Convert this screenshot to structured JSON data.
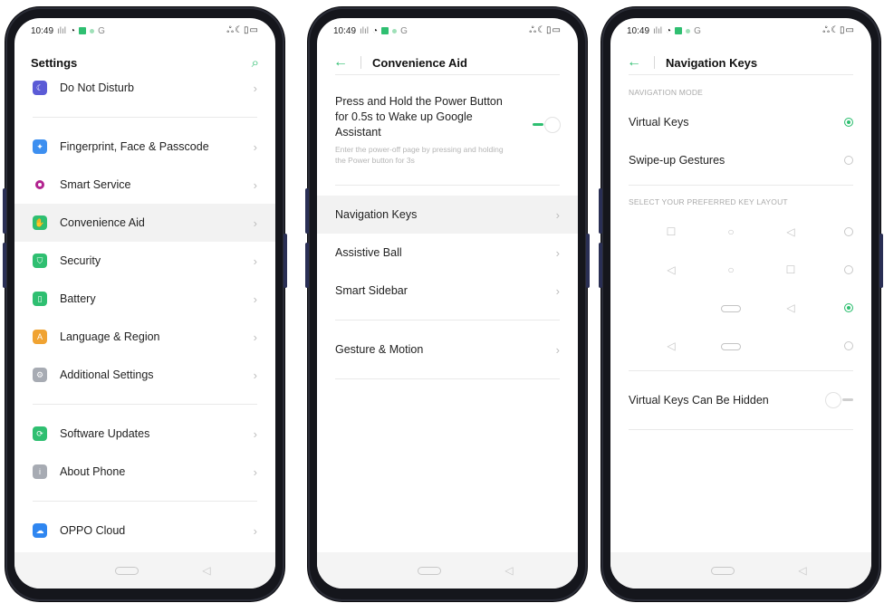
{
  "status": {
    "time": "10:49",
    "signal": "📶",
    "right_icons": "ஃ☾▯▭"
  },
  "colors": {
    "accent": "#2fbf71"
  },
  "screen1": {
    "title": "Settings",
    "search_icon": "search-icon",
    "items": [
      {
        "label": "Do Not Disturb",
        "icon": "moon-icon",
        "color": "#5b5bd6"
      },
      {
        "label": "Fingerprint, Face & Passcode",
        "icon": "fingerprint-icon",
        "color": "#3d8ff0"
      },
      {
        "label": "Smart Service",
        "icon": "circle-dot-icon",
        "color": "#b2238f"
      },
      {
        "label": "Convenience Aid",
        "icon": "hand-icon",
        "color": "#2fbf71"
      },
      {
        "label": "Security",
        "icon": "shield-icon",
        "color": "#2fbf71"
      },
      {
        "label": "Battery",
        "icon": "battery-icon",
        "color": "#2fbf71"
      },
      {
        "label": "Language & Region",
        "icon": "language-icon",
        "color": "#f0a332"
      },
      {
        "label": "Additional Settings",
        "icon": "gear-icon",
        "color": "#a7abb3"
      },
      {
        "label": "Software Updates",
        "icon": "update-icon",
        "color": "#2fbf71"
      },
      {
        "label": "About Phone",
        "icon": "info-icon",
        "color": "#a7abb3"
      },
      {
        "label": "OPPO Cloud",
        "icon": "cloud-icon",
        "color": "#2f86f0"
      }
    ]
  },
  "screen2": {
    "title": "Convenience Aid",
    "power_title": "Press and Hold the Power Button for 0.5s to Wake up Google Assistant",
    "power_desc": "Enter the power-off page by pressing and holding the Power button for 3s",
    "items": [
      {
        "label": "Navigation Keys"
      },
      {
        "label": "Assistive Ball"
      },
      {
        "label": "Smart Sidebar"
      },
      {
        "label": "Gesture & Motion"
      }
    ]
  },
  "screen3": {
    "title": "Navigation Keys",
    "section1": "NAVIGATION MODE",
    "mode_options": [
      {
        "label": "Virtual Keys",
        "selected": true
      },
      {
        "label": "Swipe-up Gestures",
        "selected": false
      }
    ],
    "section2": "SELECT YOUR PREFERRED KEY LAYOUT",
    "layouts": [
      {
        "keys": [
          "square",
          "circle",
          "back"
        ],
        "selected": false
      },
      {
        "keys": [
          "back",
          "circle",
          "square"
        ],
        "selected": false
      },
      {
        "keys": [
          "",
          "pill",
          "back"
        ],
        "selected": true
      },
      {
        "keys": [
          "back",
          "pill",
          ""
        ],
        "selected": false
      }
    ],
    "hidden_label": "Virtual Keys Can Be Hidden"
  }
}
